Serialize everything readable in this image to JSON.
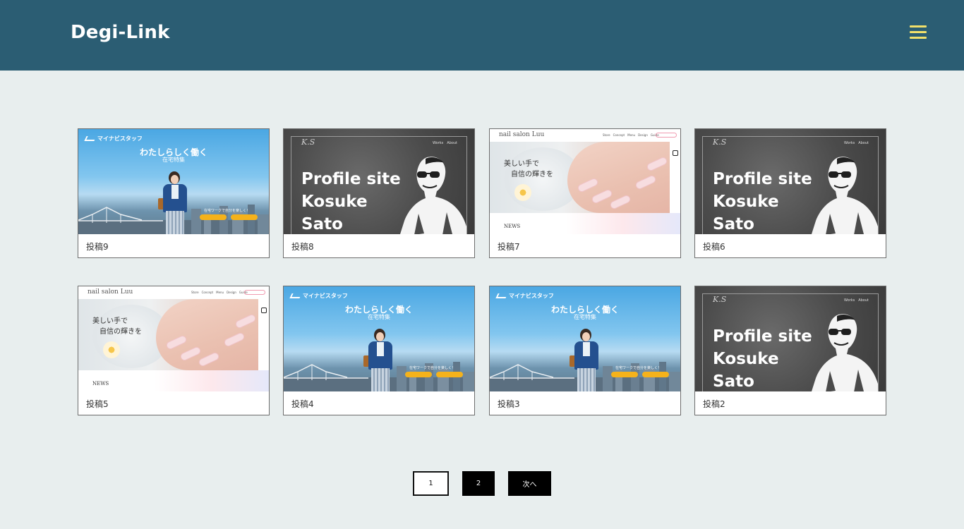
{
  "header": {
    "logo": "Degi-Link",
    "menu_icon": "hamburger-menu-icon",
    "background": "#2b5d73",
    "menu_color": "#f2e06a"
  },
  "posts": [
    {
      "title": "投稿9",
      "thumbnail": "mynavi"
    },
    {
      "title": "投稿8",
      "thumbnail": "profile"
    },
    {
      "title": "投稿7",
      "thumbnail": "nail"
    },
    {
      "title": "投稿6",
      "thumbnail": "profile"
    },
    {
      "title": "投稿5",
      "thumbnail": "nail"
    },
    {
      "title": "投稿4",
      "thumbnail": "mynavi"
    },
    {
      "title": "投稿3",
      "thumbnail": "mynavi"
    },
    {
      "title": "投稿2",
      "thumbnail": "profile"
    }
  ],
  "thumbs": {
    "mynavi": {
      "brand": "マイナビスタッフ",
      "headline": "わたしらしく働く",
      "sub": "在宅特集",
      "note": "在宅ワークで自分を楽しく！"
    },
    "profile": {
      "ks": "K.S",
      "nav": "Works　About",
      "text_lines": [
        "Profile site",
        "Kosuke",
        "Sato"
      ]
    },
    "nail": {
      "brand": "nail salon Luu",
      "nav": "Store　Concept　Menu　Design　Guide",
      "copy_lines": [
        "美しい手で",
        "自信の輝きを"
      ],
      "news": "NEWS"
    }
  },
  "pagination": {
    "page1": "1",
    "page2": "2",
    "next": "次へ",
    "current": "2"
  }
}
